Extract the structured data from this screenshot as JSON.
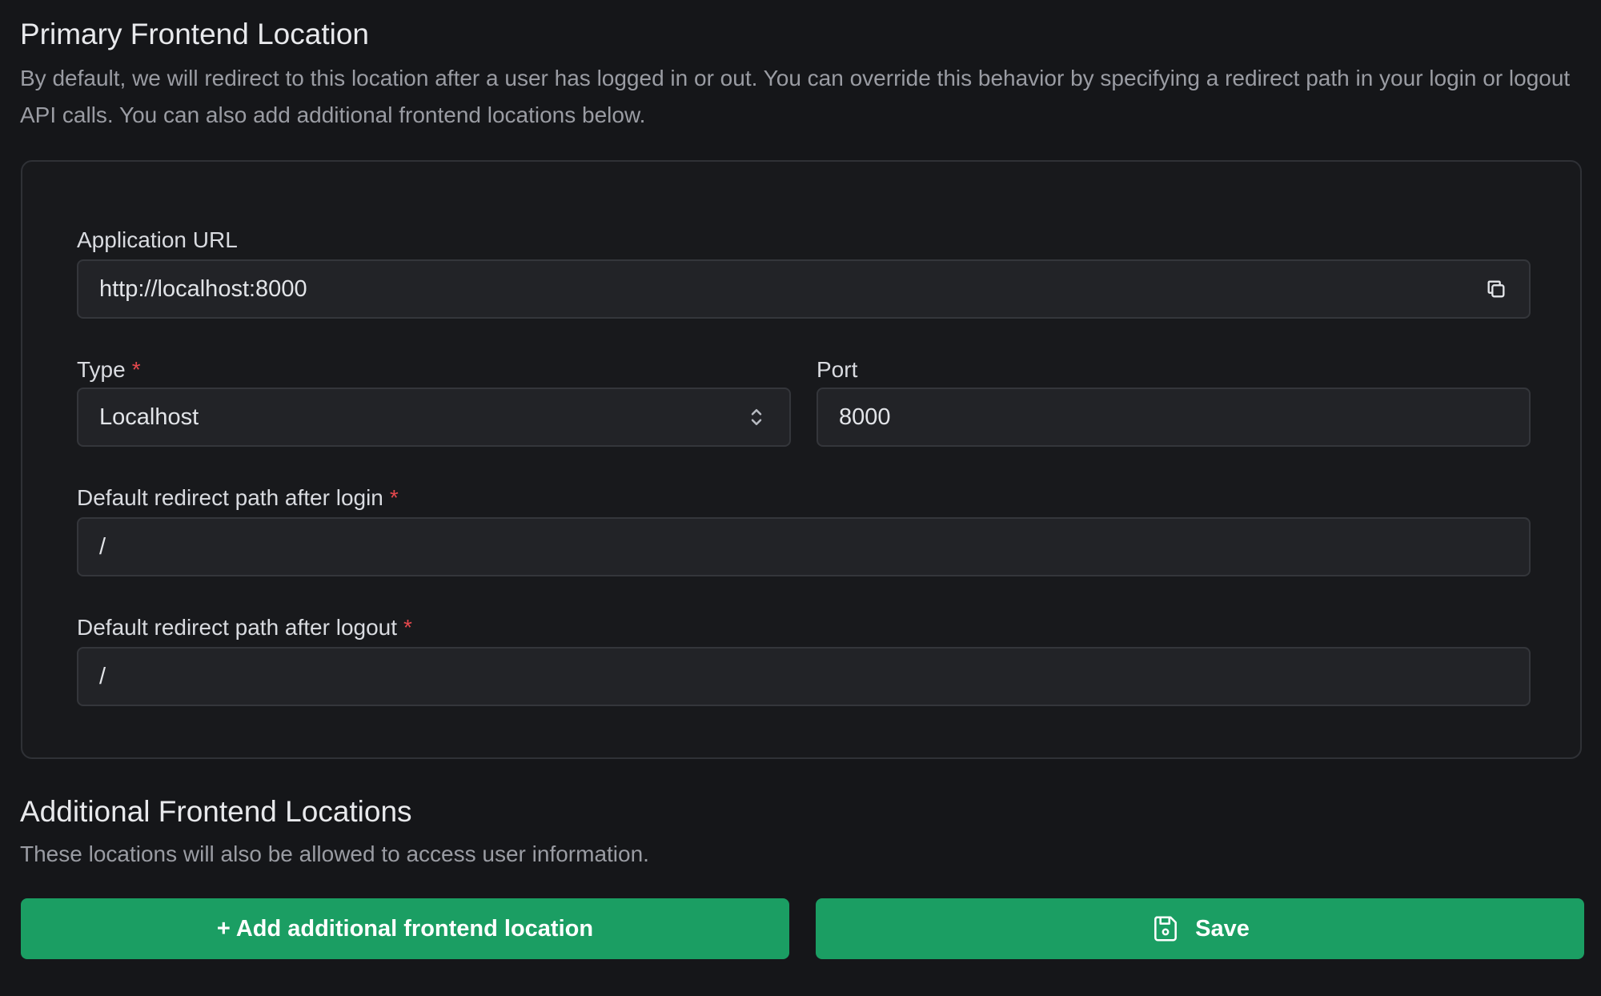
{
  "primary": {
    "title": "Primary Frontend Location",
    "description": "By default, we will redirect to this location after a user has logged in or out. You can override this behavior by specifying a redirect path in your login or logout API calls. You can also add additional frontend locations below."
  },
  "form": {
    "application_url_label": "Application URL",
    "application_url_value": "http://localhost:8000",
    "type_label": "Type",
    "type_required": "*",
    "type_value": "Localhost",
    "port_label": "Port",
    "port_value": "8000",
    "login_redirect_label": "Default redirect path after login",
    "login_redirect_required": "*",
    "login_redirect_value": "/",
    "logout_redirect_label": "Default redirect path after logout",
    "logout_redirect_required": "*",
    "logout_redirect_value": "/"
  },
  "additional": {
    "title": "Additional Frontend Locations",
    "description": "These locations will also be allowed to access user information."
  },
  "actions": {
    "add_label": "+ Add additional frontend location",
    "save_label": "Save"
  },
  "colors": {
    "accent": "#1b9e63",
    "required": "#e5484d",
    "background": "#151619"
  },
  "icons": {
    "copy": "copy-icon",
    "select": "chevron-up-down-icon",
    "save": "save-icon"
  }
}
